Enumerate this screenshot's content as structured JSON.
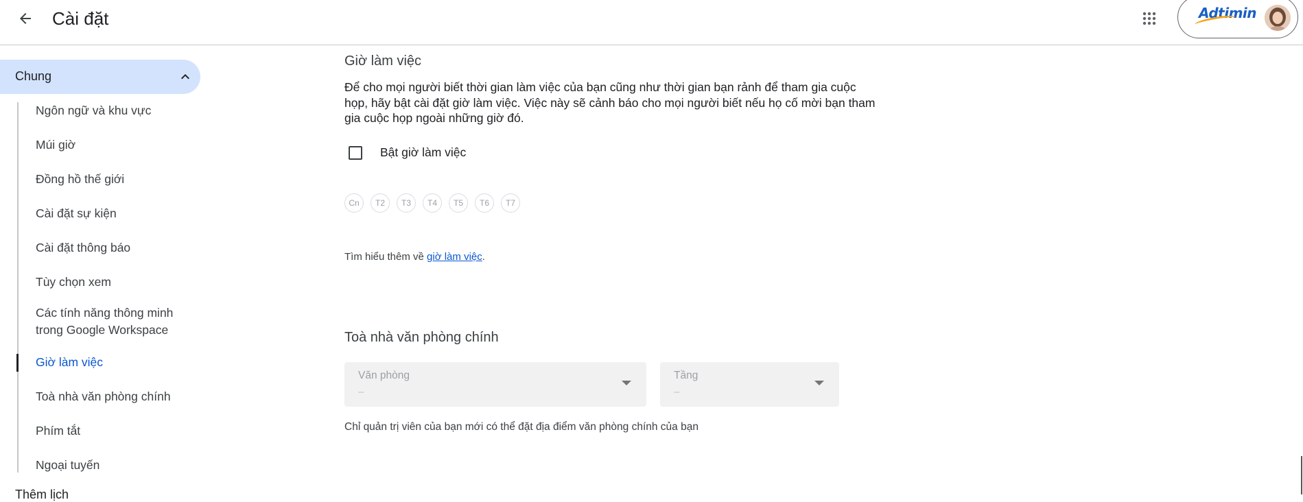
{
  "header": {
    "title": "Cài đặt",
    "brand_logo_text": "Adtimin"
  },
  "sidebar": {
    "group_label": "Chung",
    "items": [
      {
        "label": "Ngôn ngữ và khu vực"
      },
      {
        "label": "Múi giờ"
      },
      {
        "label": "Đồng hồ thế giới"
      },
      {
        "label": "Cài đặt sự kiện"
      },
      {
        "label": "Cài đặt thông báo"
      },
      {
        "label": "Tùy chọn xem"
      },
      {
        "label": "Các tính năng thông minh trong Google Workspace"
      },
      {
        "label": "Giờ làm việc",
        "active": true
      },
      {
        "label": "Toà nhà văn phòng chính"
      },
      {
        "label": "Phím tắt"
      },
      {
        "label": "Ngoại tuyến"
      }
    ],
    "next_section_label": "Thêm lịch"
  },
  "working_hours": {
    "title": "Giờ làm việc",
    "description": "Để cho mọi người biết thời gian làm việc của bạn cũng như thời gian bạn rảnh để tham gia cuộc họp, hãy bật cài đặt giờ làm việc. Việc này sẽ cảnh báo cho mọi người biết nếu họ cố mời bạn tham gia cuộc họp ngoài những giờ đó.",
    "checkbox_label": "Bật giờ làm việc",
    "checkbox_checked": false,
    "days": [
      "Cn",
      "T2",
      "T3",
      "T4",
      "T5",
      "T6",
      "T7"
    ],
    "learn_more_prefix": "Tìm hiểu thêm về ",
    "learn_more_link": "giờ làm việc",
    "learn_more_suffix": "."
  },
  "office_building": {
    "title": "Toà nhà văn phòng chính",
    "office_select": {
      "label": "Văn phòng",
      "value": "–"
    },
    "floor_select": {
      "label": "Tầng",
      "value": "–"
    },
    "note": "Chỉ quản trị viên của bạn mới có thể đặt địa điểm văn phòng chính của bạn"
  },
  "colors": {
    "accent": "#0b57d0",
    "nav_highlight": "#d3e3fd"
  }
}
